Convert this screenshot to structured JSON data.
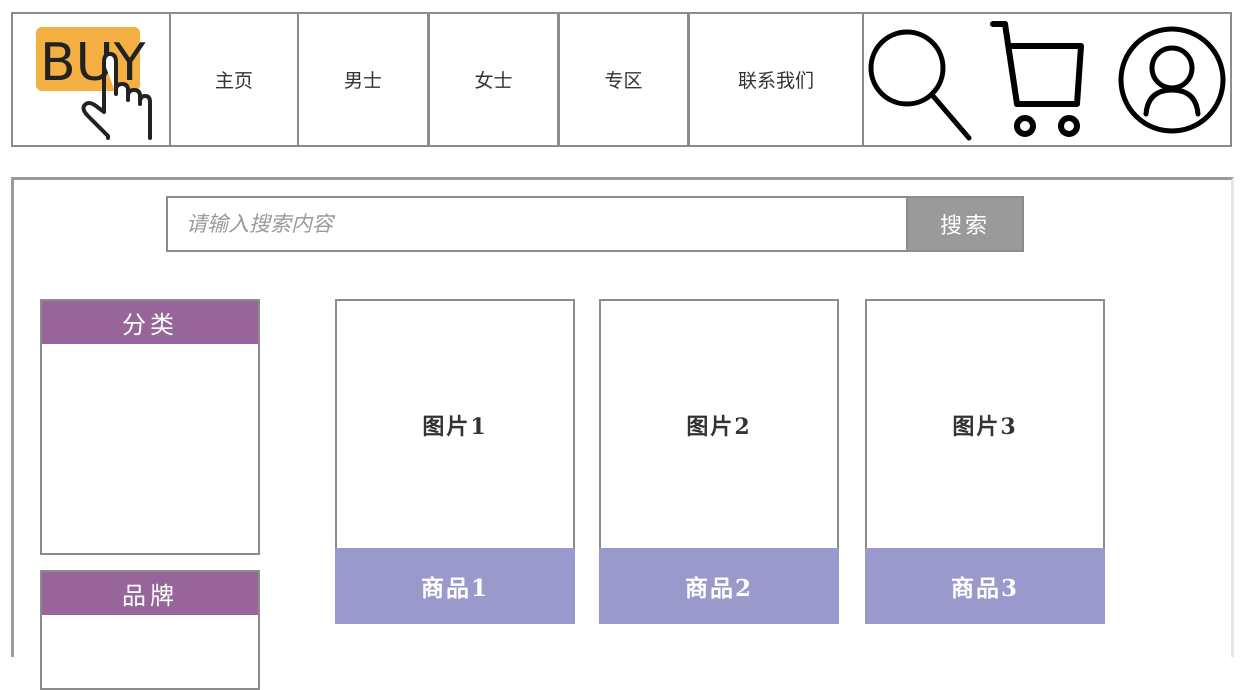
{
  "header": {
    "logo_text": "BUY",
    "nav": [
      {
        "label": "主页"
      },
      {
        "label": "男士"
      },
      {
        "label": "女士"
      },
      {
        "label": "专区"
      },
      {
        "label": "联系我们"
      }
    ],
    "icons": [
      "search-icon",
      "cart-icon",
      "user-icon"
    ]
  },
  "search": {
    "placeholder": "请输入搜索内容",
    "button_label": "搜索"
  },
  "sidebar": {
    "category_title": "分类",
    "brand_title": "品牌"
  },
  "products": [
    {
      "image_label": "图片1",
      "name": "商品1"
    },
    {
      "image_label": "图片2",
      "name": "商品2"
    },
    {
      "image_label": "图片3",
      "name": "商品3"
    }
  ],
  "colors": {
    "border": "#8c8c8c",
    "logo_bg": "#f5b043",
    "sidebar_header": "#976599",
    "product_footer": "#9999cc",
    "search_button": "#9a9a9a"
  }
}
